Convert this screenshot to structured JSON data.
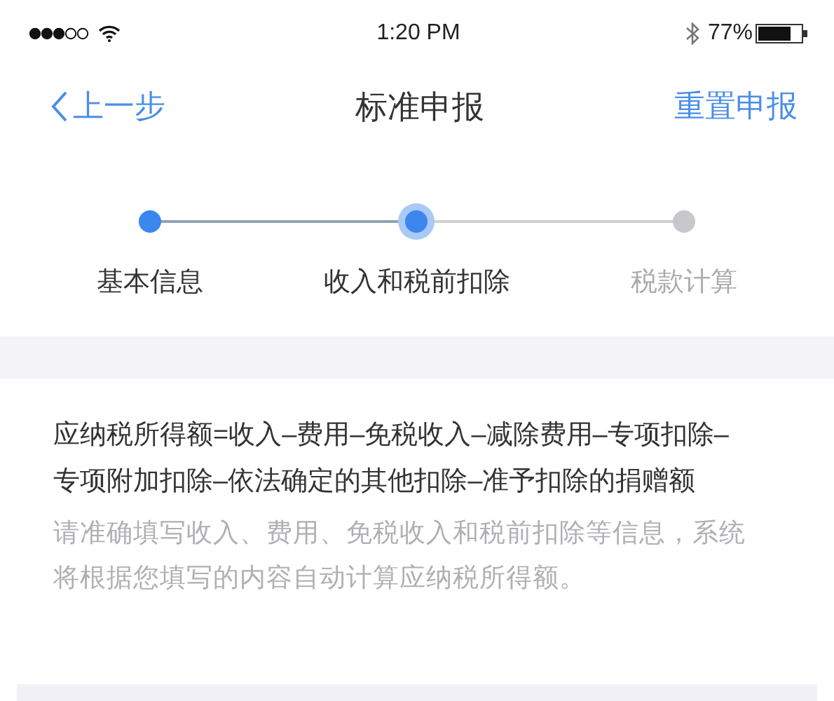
{
  "status_bar": {
    "time": "1:20 PM",
    "battery": "77%"
  },
  "nav": {
    "back": "上一步",
    "title": "标准申报",
    "action": "重置申报"
  },
  "steps": [
    {
      "label": "基本信息",
      "selected": false
    },
    {
      "label": "收入和税前扣除",
      "selected": true
    },
    {
      "label": "税款计算",
      "selected": false
    }
  ],
  "formula": "应纳税所得额=收入–费用–免税收入–减除费用–专项扣除–专项附加扣除–依法确定的其他扣除–准予扣除的捐赠额",
  "hint": "请准确填写收入、费用、免税收入和税前扣除等信息，系统将根据您填写的内容自动计算应纳税所得额。"
}
